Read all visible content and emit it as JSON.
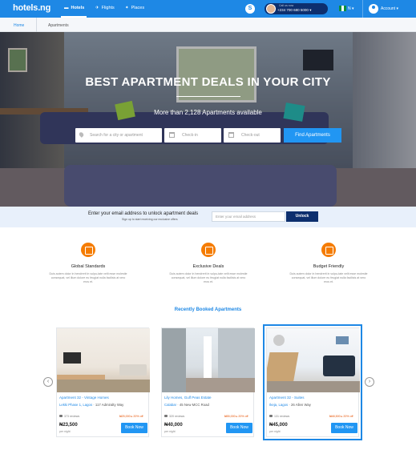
{
  "brand": {
    "logo": "hotels.ng"
  },
  "nav": {
    "items": [
      {
        "label": "Hotels",
        "active": true
      },
      {
        "label": "Flights",
        "active": false
      },
      {
        "label": "Places",
        "active": false
      }
    ],
    "phone_label": "Call us now",
    "phone_number": "+234 700 680 5000",
    "language": "N",
    "account": "Account"
  },
  "breadcrumb": {
    "home": "Home",
    "current": "Apartments"
  },
  "hero": {
    "title": "BEST APARTMENT DEALS IN YOUR CITY",
    "subtitle": "More than 2,128 Apartments available",
    "search_placeholder": "Search for a city or apartment",
    "checkin_placeholder": "Check-in",
    "checkout_placeholder": "Check-out",
    "find_button": "Find Apartments"
  },
  "newsletter": {
    "title": "Enter your email address to unlock apartment deals",
    "subtitle": "Sign up to start receiving our exclusive offers",
    "placeholder": "Enter your email address",
    "button": "Unlock"
  },
  "features": [
    {
      "title": "Global Standards",
      "desc": "Duis autem dolor in hendrerit in vulpu-tate velit esse molestie consequat, vel illum dolore eu feugiat nulla facilisis at vero eros et."
    },
    {
      "title": "Exclusive Deals",
      "desc": "Duis autem dolor in hendrerit in vulpu-tate velit esse molestie consequat, vel illum dolore eu feugiat nulla facilisis at vero eros et."
    },
    {
      "title": "Budget Friendly",
      "desc": "Duis autem dolor in hendrerit in vulpu-tate velit esse molestie consequat, vel illum dolore eu feugiat nulla facilisis at vero eros et."
    }
  ],
  "recent": {
    "title": "Recently Booked Apartments",
    "prev": "‹",
    "next": "›",
    "cards": [
      {
        "name": "Apartment 32 - Vintage Homes",
        "city": "Lekki Phase 1, Lagos",
        "address": "117 Admiralty Way",
        "reviews": "373 reviews",
        "old_price": "₦25,000 ▸ 20% off",
        "price": "₦23,500",
        "per": "per night",
        "book": "Book Now",
        "selected": false
      },
      {
        "name": "Lily Homes, Gulf Peas Estate",
        "city": "Calabar",
        "address": "45 New MCC Road",
        "reviews": "320 reviews",
        "old_price": "₦55,000 ▸ 20% off",
        "price": "₦40,000",
        "per": "per night",
        "book": "Book Now",
        "selected": false
      },
      {
        "name": "Apartment 32 - Suites",
        "city": "Ikeja, Lagos",
        "address": "26 Allen Way",
        "reviews": "131 reviews",
        "old_price": "₦48,500 ▸ 20% off",
        "price": "₦45,000",
        "per": "per night",
        "book": "Book Now",
        "selected": true
      }
    ]
  },
  "colors": {
    "primary": "#1e88e5",
    "navy": "#0d2f6e",
    "accent": "#f57c00"
  }
}
